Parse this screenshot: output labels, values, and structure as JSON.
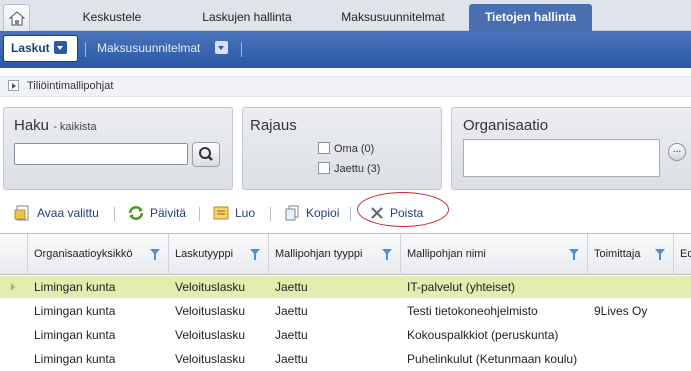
{
  "top_tabs": [
    {
      "label": "Keskustele"
    },
    {
      "label": "Laskujen hallinta"
    },
    {
      "label": "Maksusuunnitelmat"
    },
    {
      "label": "Tietojen hallinta"
    }
  ],
  "nav": {
    "active_label": "Laskut",
    "second_label": "Maksusuunnitelmat"
  },
  "breadcrumb": {
    "label": "Tiliöintimallipohjat"
  },
  "search_panel": {
    "title": "Haku",
    "subtitle": "- kaikista",
    "input_value": ""
  },
  "limit_panel": {
    "title": "Rajaus",
    "options": [
      {
        "label": "Oma (0)",
        "checked": false
      },
      {
        "label": "Jaettu (3)",
        "checked": false
      }
    ]
  },
  "org_panel": {
    "title": "Organisaatio",
    "button_label": "..."
  },
  "toolbar": {
    "open_label": "Avaa valittu",
    "refresh_label": "Päivitä",
    "create_label": "Luo",
    "copy_label": "Kopioi",
    "delete_label": "Poista"
  },
  "grid": {
    "columns": [
      {
        "label": "Organisaatioyksikkö"
      },
      {
        "label": "Laskutyyppi"
      },
      {
        "label": "Mallipohjan tyyppi"
      },
      {
        "label": "Mallipohjan nimi"
      },
      {
        "label": "Toimittaja"
      },
      {
        "label": "Ed"
      }
    ],
    "rows": [
      {
        "org": "Limingan kunta",
        "type": "Veloituslasku",
        "template_type": "Jaettu",
        "name": "IT-palvelut (yhteiset)",
        "supplier": "",
        "selected": true
      },
      {
        "org": "Limingan kunta",
        "type": "Veloituslasku",
        "template_type": "Jaettu",
        "name": "Testi tietokoneohjelmisto",
        "supplier": "9Lives Oy",
        "selected": false
      },
      {
        "org": "Limingan kunta",
        "type": "Veloituslasku",
        "template_type": "Jaettu",
        "name": "Kokouspalkkiot (peruskunta)",
        "supplier": "",
        "selected": false
      },
      {
        "org": "Limingan kunta",
        "type": "Veloituslasku",
        "template_type": "Jaettu",
        "name": "Puhelinkulut (Ketunmaan koulu)",
        "supplier": "",
        "selected": false
      }
    ]
  }
}
